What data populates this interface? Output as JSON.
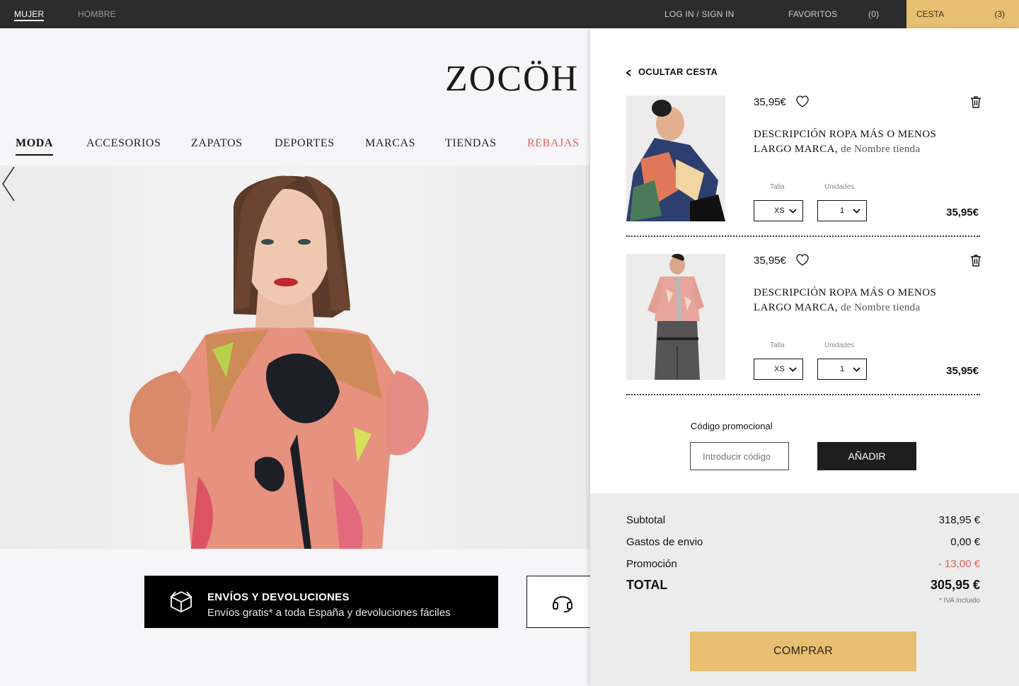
{
  "topbar": {
    "mujer": "MUJER",
    "hombre": "HOMBRE",
    "login": "LOG IN / SIGN IN",
    "favoritos": "FAVORITOS",
    "favoritos_count": "(0)",
    "cesta": "CESTA",
    "cesta_count": "(3)"
  },
  "brand": {
    "logo": "ZOCÖH"
  },
  "nav": {
    "items": [
      "MODA",
      "ACCESORIOS",
      "ZAPATOS",
      "DEPORTES",
      "MARCAS",
      "TIENDAS",
      "REBAJAS"
    ]
  },
  "hero": {
    "arrow_icon": "chevron-left-icon"
  },
  "shipping": {
    "title": "ENVÍOS Y DEVOLUCIONES",
    "text": "Envíos gratis* a toda España y devoluciones fáciles",
    "icon": "box-icon"
  },
  "help": {
    "icon": "headset-icon"
  },
  "cart": {
    "hide_label": "OCULTAR CESTA",
    "items": [
      {
        "price": "35,95€",
        "desc_main": "DESCRIPCIÓN ROPA MÁS O MENOS LARGO",
        "brand": "MARCA,",
        "store": "de Nombre tienda",
        "talla_label": "Talla",
        "unidades_label": "Unidades",
        "talla": "XS",
        "unidades": "1",
        "total": "35,95€"
      },
      {
        "price": "35,95€",
        "desc_main": "DESCRIPCIÓN ROPA MÁS O MENOS LARGO",
        "brand": "MARCA,",
        "store": "de Nombre tienda",
        "talla_label": "Talla",
        "unidades_label": "Unidades",
        "talla": "XS",
        "unidades": "1",
        "total": "35,95€"
      }
    ],
    "promo_label": "Código promocional",
    "promo_placeholder": "Introducir código",
    "promo_button": "AÑADIR",
    "subtotal_label": "Subtotal",
    "subtotal": "318,95 €",
    "shipping_label": "Gastos de envio",
    "shipping": "0,00 €",
    "promotion_label": "Promoción",
    "promotion": "- 13,00 €",
    "total_label": "TOTAL",
    "total": "305,95 €",
    "iva_note": "* IVA incluido",
    "buy_button": "COMPRAR"
  },
  "colors": {
    "accent": "#e8bf70",
    "topbar": "#2c2c2c",
    "sale": "#e0625d"
  }
}
